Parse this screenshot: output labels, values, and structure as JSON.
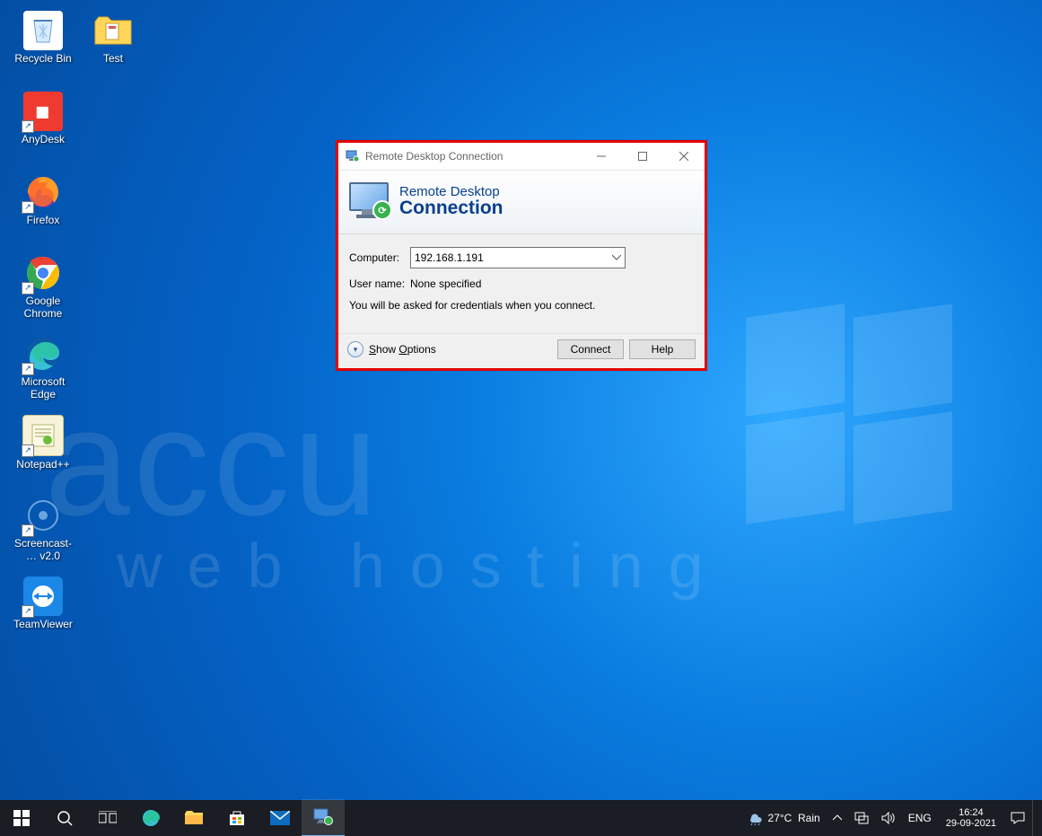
{
  "desktop_icons_col1": [
    {
      "label": "Recycle Bin",
      "name": "recycle-bin",
      "shortcut": false,
      "bg": "#ffffff",
      "gly": "♻",
      "gcol": "#1f7fd6"
    },
    {
      "label": "AnyDesk",
      "name": "anydesk",
      "shortcut": true,
      "bg": "#ef3b2f",
      "gly": "◆",
      "gcol": "#ffffff"
    },
    {
      "label": "Firefox",
      "name": "firefox",
      "shortcut": true,
      "bg": "",
      "gly": "",
      "gcol": ""
    },
    {
      "label": "Google Chrome",
      "name": "google-chrome",
      "shortcut": true,
      "bg": "",
      "gly": "",
      "gcol": ""
    },
    {
      "label": "Microsoft Edge",
      "name": "microsoft-edge",
      "shortcut": true,
      "bg": "",
      "gly": "",
      "gcol": ""
    },
    {
      "label": "Notepad++",
      "name": "notepad-plus-plus",
      "shortcut": true,
      "bg": "#f6f3d8",
      "gly": "N",
      "gcol": "#4a8a2a"
    },
    {
      "label": "Screencast-… v2.0",
      "name": "screencast",
      "shortcut": true,
      "bg": "",
      "gly": "◯",
      "gcol": "#bfe6ff"
    },
    {
      "label": "TeamViewer",
      "name": "teamviewer",
      "shortcut": true,
      "bg": "#1b87e6",
      "gly": "↔",
      "gcol": "#ffffff"
    }
  ],
  "desktop_icons_col2": [
    {
      "label": "Test",
      "name": "test-folder",
      "shortcut": false,
      "bg": "#ffd65a",
      "gly": "",
      "gcol": ""
    }
  ],
  "watermark": {
    "line1": "accu",
    "line2": "web hosting"
  },
  "rdc": {
    "window_title": "Remote Desktop Connection",
    "banner_line1": "Remote Desktop",
    "banner_line2": "Connection",
    "computer_label": "Computer:",
    "computer_value": "192.168.1.191",
    "username_label": "User name:",
    "username_value": "None specified",
    "hint": "You will be asked for credentials when you connect.",
    "show_options": "Show Options",
    "connect": "Connect",
    "help": "Help"
  },
  "taskbar": {
    "weather_temp": "27°C",
    "weather_cond": "Rain",
    "lang": "ENG",
    "time": "16:24",
    "date": "29-09-2021"
  }
}
